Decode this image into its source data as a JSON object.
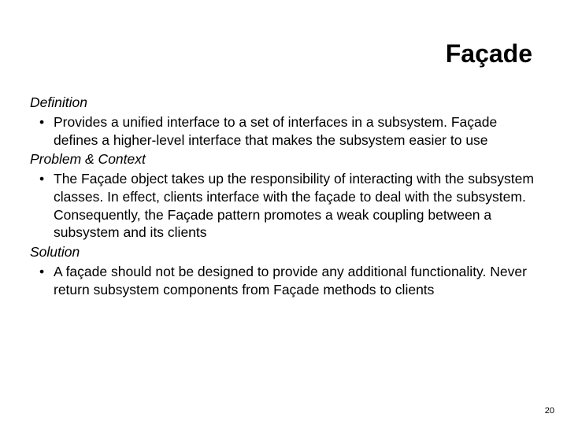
{
  "title": "Façade",
  "sections": {
    "definition": {
      "label": "Definition",
      "bullets": [
        "Provides a unified interface to a set of interfaces in a subsystem. Façade defines a higher-level interface that makes the subsystem easier to use"
      ]
    },
    "problem": {
      "label": "Problem & Context",
      "bullets": [
        "The Façade object takes up the responsibility of interacting with the subsystem classes. In effect, clients interface with the façade to deal with the subsystem. Consequently,  the Façade pattern promotes a weak coupling between a subsystem and its clients"
      ]
    },
    "solution": {
      "label": "Solution",
      "bullets": [
        "A façade should not be designed to provide any additional functionality. Never return subsystem components from Façade methods to clients"
      ]
    }
  },
  "page_number": "20"
}
